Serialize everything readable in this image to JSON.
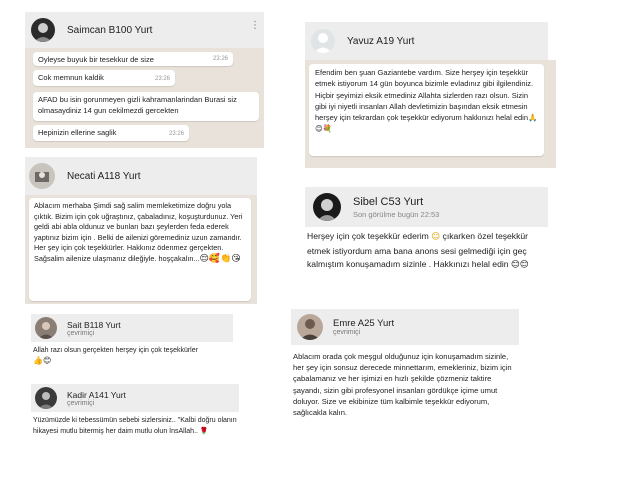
{
  "saimcan": {
    "name": "Saimcan B100 Yurt",
    "messages": [
      {
        "text": "Oyleyse buyuk bir tesekkur de size",
        "time": "23:26"
      },
      {
        "text": "Cok memnun kaldik",
        "time": "23:26"
      },
      {
        "text": "AFAD bu isin gorunmeyen gizli kahramanlarindan Burasi siz olmasaydiniz 14 gun cekilmezdi gercekten",
        "time": "23:26"
      },
      {
        "text": "Hepinizin ellerine saglik",
        "time": "23:26"
      }
    ]
  },
  "yavuz": {
    "name": "Yavuz A19 Yurt",
    "message": "Efendim ben şuan Gaziantebe vardım. Size herşey için teşekkür etmek istiyorum 14 gün boyunca bizimle evladınız gibi ilgilendiniz. Hiçbir şeyimizi eksik etmediniz Allahta sizlerden razı olsun. Sizin gibi iyi niyetli insanları Allah devletimizin başından eksik etmesin herşey için tekrardan çok teşekkür ediyorum hakkınızı helal edin",
    "emojis": "🙏😊💐"
  },
  "necati": {
    "name": "Necati A118 Yurt",
    "message": "Ablacım merhaba Şimdi sağ salim memleketimize doğru yola çıktık. Bizim için çok uğraştınız, çabaladınız, koşuşturdunuz. Yeri geldi abi abla oldunuz ve bunları bazı şeylerden feda ederek yaptınız bizim için . Belki de ailenizi göremediniz uzun zamandır. Her şey için çok teşekkürler. Hakkınız ödenmez gerçekten. Sağsalim ailenize ulaşmanız dileğiyle. hoşçakalın...",
    "emojis": "😌🥰👏😘"
  },
  "sibel": {
    "name": "Sibel C53 Yurt",
    "status": "Son görülme bugün 22:53",
    "message_part1": "Herşey için çok teşekkür ederim",
    "message_part2": "çıkarken özel teşekkür etmek istiyordum ama bana anons sesi gelmediği için geç kalmıştım konuşamadım sizinle . Hakkınızı helal edin",
    "emoji_mid": "☺",
    "emojis_end": "😊😊"
  },
  "sait": {
    "name": "Sait B118 Yurt",
    "status": "çevrimiçi",
    "message": "Allah razı olsun gerçekten herşey için çok teşekkürler",
    "emojis": "👍😊"
  },
  "emre": {
    "name": "Emre A25 Yurt",
    "status": "çevrimiçi",
    "message": "Ablacım orada çok meşgul olduğunuz için konuşamadım sizinle, her şey için sonsuz derecede minnettarım, emekleriniz, bizim için çabalamanız ve her işimizi en hızlı şekilde çözmeniz taktire şayandı, sizin gibi profesyonel insanları gördükçe içime umut doluyor. Size ve ekibinize tüm kalbimle teşekkür ediyorum, sağlıcakla kalın."
  },
  "kadir": {
    "name": "Kadir A141 Yurt",
    "status": "çevrimiçi",
    "message": "Yüzümüzde ki tebessümün sebebi sizlersiniz.. \"Kalbi doğru olanın hikayesi mutlu bitermiş her daim mutlu olun İnsAllah..",
    "emojis": "🌹"
  },
  "menu_icon_name": "more-vertical-icon",
  "colors": {
    "header_bg": "#ededed",
    "chat_bg": "#e9e2da",
    "bubble_bg": "#ffffff"
  }
}
